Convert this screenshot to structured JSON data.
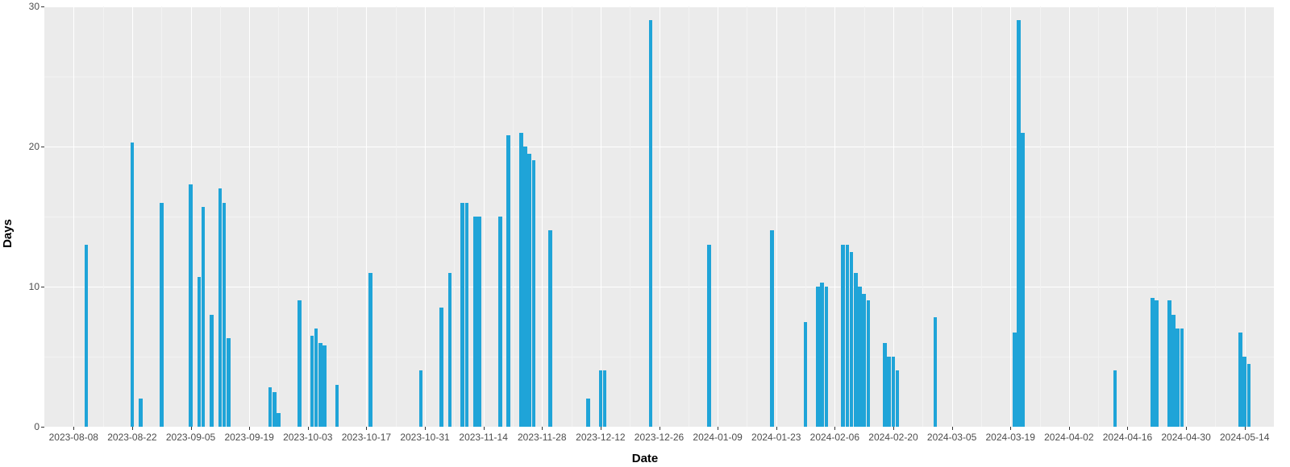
{
  "chart_data": {
    "type": "bar",
    "xlabel": "Date",
    "ylabel": "Days",
    "ylim": [
      0,
      30
    ],
    "y_ticks": [
      0,
      10,
      20,
      30
    ],
    "y_minor_ticks": [
      5,
      15,
      25
    ],
    "x_ticks": [
      "2023-08-08",
      "2023-08-22",
      "2023-09-05",
      "2023-09-19",
      "2023-10-03",
      "2023-10-17",
      "2023-10-31",
      "2023-11-14",
      "2023-11-28",
      "2023-12-12",
      "2023-12-26",
      "2024-01-09",
      "2024-01-23",
      "2024-02-06",
      "2024-02-20",
      "2024-03-05",
      "2024-03-19",
      "2024-04-02",
      "2024-04-16",
      "2024-04-30",
      "2024-05-14"
    ],
    "bars": [
      {
        "date": "2023-08-11",
        "value": 13
      },
      {
        "date": "2023-08-22",
        "value": 20.3
      },
      {
        "date": "2023-08-24",
        "value": 2
      },
      {
        "date": "2023-08-29",
        "value": 16
      },
      {
        "date": "2023-09-05",
        "value": 17.3
      },
      {
        "date": "2023-09-07",
        "value": 10.7
      },
      {
        "date": "2023-09-08",
        "value": 15.7
      },
      {
        "date": "2023-09-10",
        "value": 8
      },
      {
        "date": "2023-09-12",
        "value": 17
      },
      {
        "date": "2023-09-13",
        "value": 16
      },
      {
        "date": "2023-09-14",
        "value": 6.3
      },
      {
        "date": "2023-09-24",
        "value": 2.8
      },
      {
        "date": "2023-09-25",
        "value": 2.5
      },
      {
        "date": "2023-09-26",
        "value": 1
      },
      {
        "date": "2023-10-01",
        "value": 9
      },
      {
        "date": "2023-10-04",
        "value": 6.5
      },
      {
        "date": "2023-10-05",
        "value": 7
      },
      {
        "date": "2023-10-06",
        "value": 6
      },
      {
        "date": "2023-10-07",
        "value": 5.8
      },
      {
        "date": "2023-10-10",
        "value": 3
      },
      {
        "date": "2023-10-18",
        "value": 11
      },
      {
        "date": "2023-10-30",
        "value": 4
      },
      {
        "date": "2023-11-04",
        "value": 8.5
      },
      {
        "date": "2023-11-06",
        "value": 11
      },
      {
        "date": "2023-11-09",
        "value": 16
      },
      {
        "date": "2023-11-10",
        "value": 16
      },
      {
        "date": "2023-11-12",
        "value": 15
      },
      {
        "date": "2023-11-13",
        "value": 15
      },
      {
        "date": "2023-11-18",
        "value": 15
      },
      {
        "date": "2023-11-20",
        "value": 20.8
      },
      {
        "date": "2023-11-23",
        "value": 21
      },
      {
        "date": "2023-11-24",
        "value": 20
      },
      {
        "date": "2023-11-25",
        "value": 19.5
      },
      {
        "date": "2023-11-26",
        "value": 19
      },
      {
        "date": "2023-11-30",
        "value": 14
      },
      {
        "date": "2023-12-09",
        "value": 2
      },
      {
        "date": "2023-12-12",
        "value": 4
      },
      {
        "date": "2023-12-13",
        "value": 4
      },
      {
        "date": "2023-12-24",
        "value": 29
      },
      {
        "date": "2024-01-07",
        "value": 13
      },
      {
        "date": "2024-01-22",
        "value": 14
      },
      {
        "date": "2024-01-30",
        "value": 7.5
      },
      {
        "date": "2024-02-02",
        "value": 10
      },
      {
        "date": "2024-02-03",
        "value": 10.3
      },
      {
        "date": "2024-02-04",
        "value": 10
      },
      {
        "date": "2024-02-08",
        "value": 13
      },
      {
        "date": "2024-02-09",
        "value": 13
      },
      {
        "date": "2024-02-10",
        "value": 12.5
      },
      {
        "date": "2024-02-11",
        "value": 11
      },
      {
        "date": "2024-02-12",
        "value": 10
      },
      {
        "date": "2024-02-13",
        "value": 9.5
      },
      {
        "date": "2024-02-14",
        "value": 9
      },
      {
        "date": "2024-02-18",
        "value": 6
      },
      {
        "date": "2024-02-19",
        "value": 5
      },
      {
        "date": "2024-02-20",
        "value": 5
      },
      {
        "date": "2024-02-21",
        "value": 4
      },
      {
        "date": "2024-03-01",
        "value": 7.8
      },
      {
        "date": "2024-03-20",
        "value": 6.7
      },
      {
        "date": "2024-03-21",
        "value": 29
      },
      {
        "date": "2024-03-22",
        "value": 21
      },
      {
        "date": "2024-04-13",
        "value": 4
      },
      {
        "date": "2024-04-22",
        "value": 9.2
      },
      {
        "date": "2024-04-23",
        "value": 9
      },
      {
        "date": "2024-04-26",
        "value": 9
      },
      {
        "date": "2024-04-27",
        "value": 8
      },
      {
        "date": "2024-04-28",
        "value": 7
      },
      {
        "date": "2024-04-29",
        "value": 7
      },
      {
        "date": "2024-05-13",
        "value": 6.7
      },
      {
        "date": "2024-05-14",
        "value": 5
      },
      {
        "date": "2024-05-15",
        "value": 4.5
      }
    ],
    "bar_color": "#1fa4d8",
    "panel_bg": "#ebebeb",
    "x_domain": [
      "2023-08-01",
      "2024-05-21"
    ]
  }
}
